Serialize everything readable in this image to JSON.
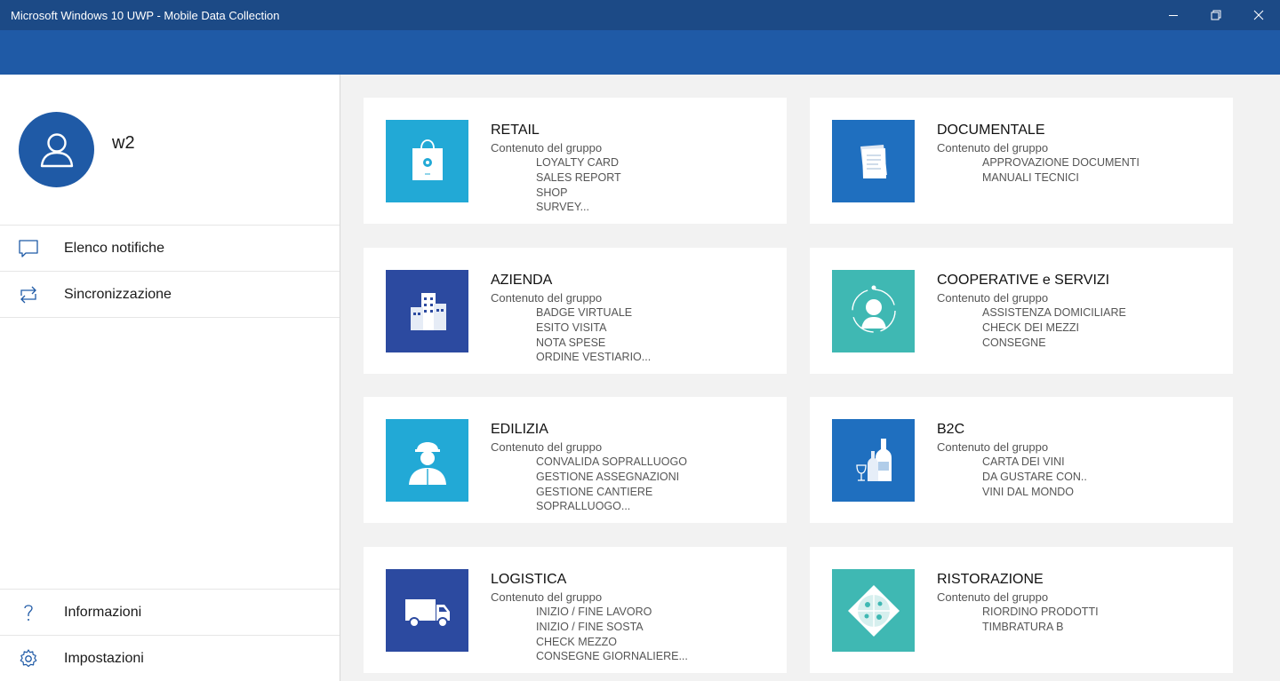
{
  "window": {
    "title": "Microsoft Windows 10 UWP - Mobile Data Collection"
  },
  "profile": {
    "username": "w2"
  },
  "nav": {
    "top": [
      {
        "label": "Elenco notifiche",
        "icon": "chat-icon"
      },
      {
        "label": "Sincronizzazione",
        "icon": "sync-icon"
      }
    ],
    "bottom": [
      {
        "label": "Informazioni",
        "icon": "question-icon"
      },
      {
        "label": "Impostazioni",
        "icon": "gear-icon"
      }
    ]
  },
  "colors": {
    "titlebar": "#1c4a86",
    "appbar": "#1f5aa6",
    "tile_cyan": "#22a9d6",
    "tile_navy": "#2c4aa0",
    "tile_blue": "#1f6fbf",
    "tile_teal": "#3fb8b3"
  },
  "groups": [
    {
      "title": "RETAIL",
      "subtitle": "Contenuto del gruppo",
      "items": [
        "LOYALTY CARD",
        "SALES REPORT",
        "SHOP",
        "SURVEY..."
      ],
      "icon": "shopping-bag-icon",
      "color": "#22a9d6"
    },
    {
      "title": "DOCUMENTALE",
      "subtitle": "Contenuto del gruppo",
      "items": [
        "APPROVAZIONE DOCUMENTI",
        "MANUALI TECNICI"
      ],
      "icon": "documents-icon",
      "color": "#1f6fbf"
    },
    {
      "title": "AZIENDA",
      "subtitle": "Contenuto del gruppo",
      "items": [
        "BADGE VIRTUALE",
        "ESITO VISITA",
        "NOTA SPESE",
        "ORDINE VESTIARIO..."
      ],
      "icon": "buildings-icon",
      "color": "#2c4aa0"
    },
    {
      "title": "COOPERATIVE e SERVIZI",
      "subtitle": "Contenuto del gruppo",
      "items": [
        "ASSISTENZA DOMICILIARE",
        "CHECK DEI MEZZI",
        "CONSEGNE"
      ],
      "icon": "caregiver-icon",
      "color": "#3fb8b3"
    },
    {
      "title": "EDILIZIA",
      "subtitle": "Contenuto del gruppo",
      "items": [
        "CONVALIDA SOPRALLUOGO",
        "GESTIONE ASSEGNAZIONI",
        "GESTIONE CANTIERE",
        "SOPRALLUOGO..."
      ],
      "icon": "construction-worker-icon",
      "color": "#22a9d6"
    },
    {
      "title": "B2C",
      "subtitle": "Contenuto del gruppo",
      "items": [
        "CARTA DEI VINI",
        "DA GUSTARE CON..",
        "VINI DAL MONDO"
      ],
      "icon": "wine-bottles-icon",
      "color": "#1f6fbf"
    },
    {
      "title": "LOGISTICA",
      "subtitle": "Contenuto del gruppo",
      "items": [
        "INIZIO / FINE LAVORO",
        "INIZIO / FINE SOSTA",
        "CHECK MEZZO",
        "CONSEGNE GIORNALIERE..."
      ],
      "icon": "delivery-truck-icon",
      "color": "#2c4aa0"
    },
    {
      "title": "RISTORAZIONE",
      "subtitle": "Contenuto del gruppo",
      "items": [
        "RIORDINO PRODOTTI",
        "TIMBRATURA B"
      ],
      "icon": "pizza-icon",
      "color": "#3fb8b3"
    }
  ]
}
